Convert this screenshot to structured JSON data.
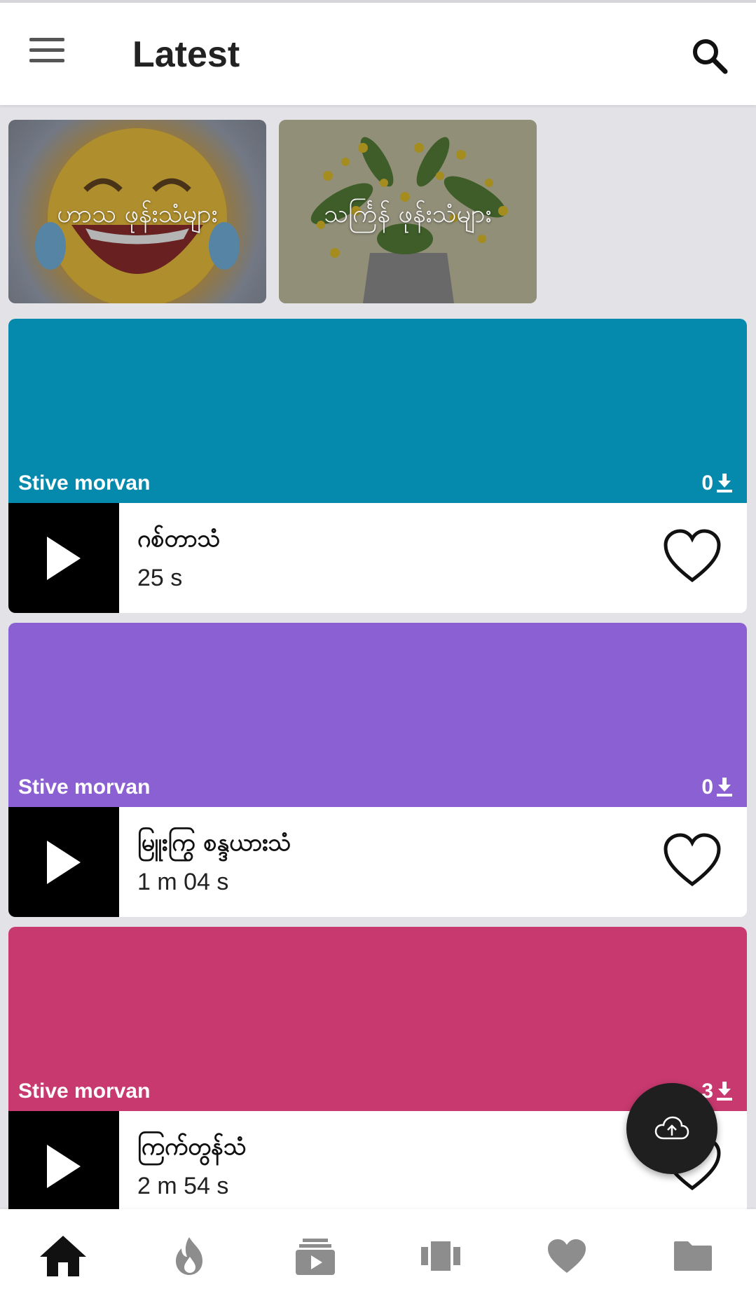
{
  "header": {
    "title": "Latest",
    "menu_icon": "hamburger-menu-icon",
    "search_icon": "search-icon"
  },
  "categories": [
    {
      "label": "ဟာသ ဖုန်းသံများ"
    },
    {
      "label": "သင်္ကြန် ဖုန်းသံများ"
    }
  ],
  "ringtones": [
    {
      "author": "Stive morvan",
      "downloads": "0",
      "name": "ဂစ်တာသံ",
      "duration": "25 s",
      "color": "#0589ad"
    },
    {
      "author": "Stive morvan",
      "downloads": "0",
      "name": "မြူးကြွ စန္ဒယားသံ",
      "duration": "1 m 04 s",
      "color": "#8b60d3"
    },
    {
      "author": "Stive morvan",
      "downloads": "3",
      "name": "ကြက်တွန်သံ",
      "duration": "2 m 54 s",
      "color": "#c7396f"
    }
  ],
  "fab": {
    "icon": "cloud-upload-icon"
  },
  "bottom_nav": [
    {
      "icon": "home-icon",
      "active": true
    },
    {
      "icon": "fire-icon",
      "active": false
    },
    {
      "icon": "playlist-icon",
      "active": false
    },
    {
      "icon": "carousel-icon",
      "active": false
    },
    {
      "icon": "heart-icon",
      "active": false
    },
    {
      "icon": "folder-icon",
      "active": false
    }
  ]
}
